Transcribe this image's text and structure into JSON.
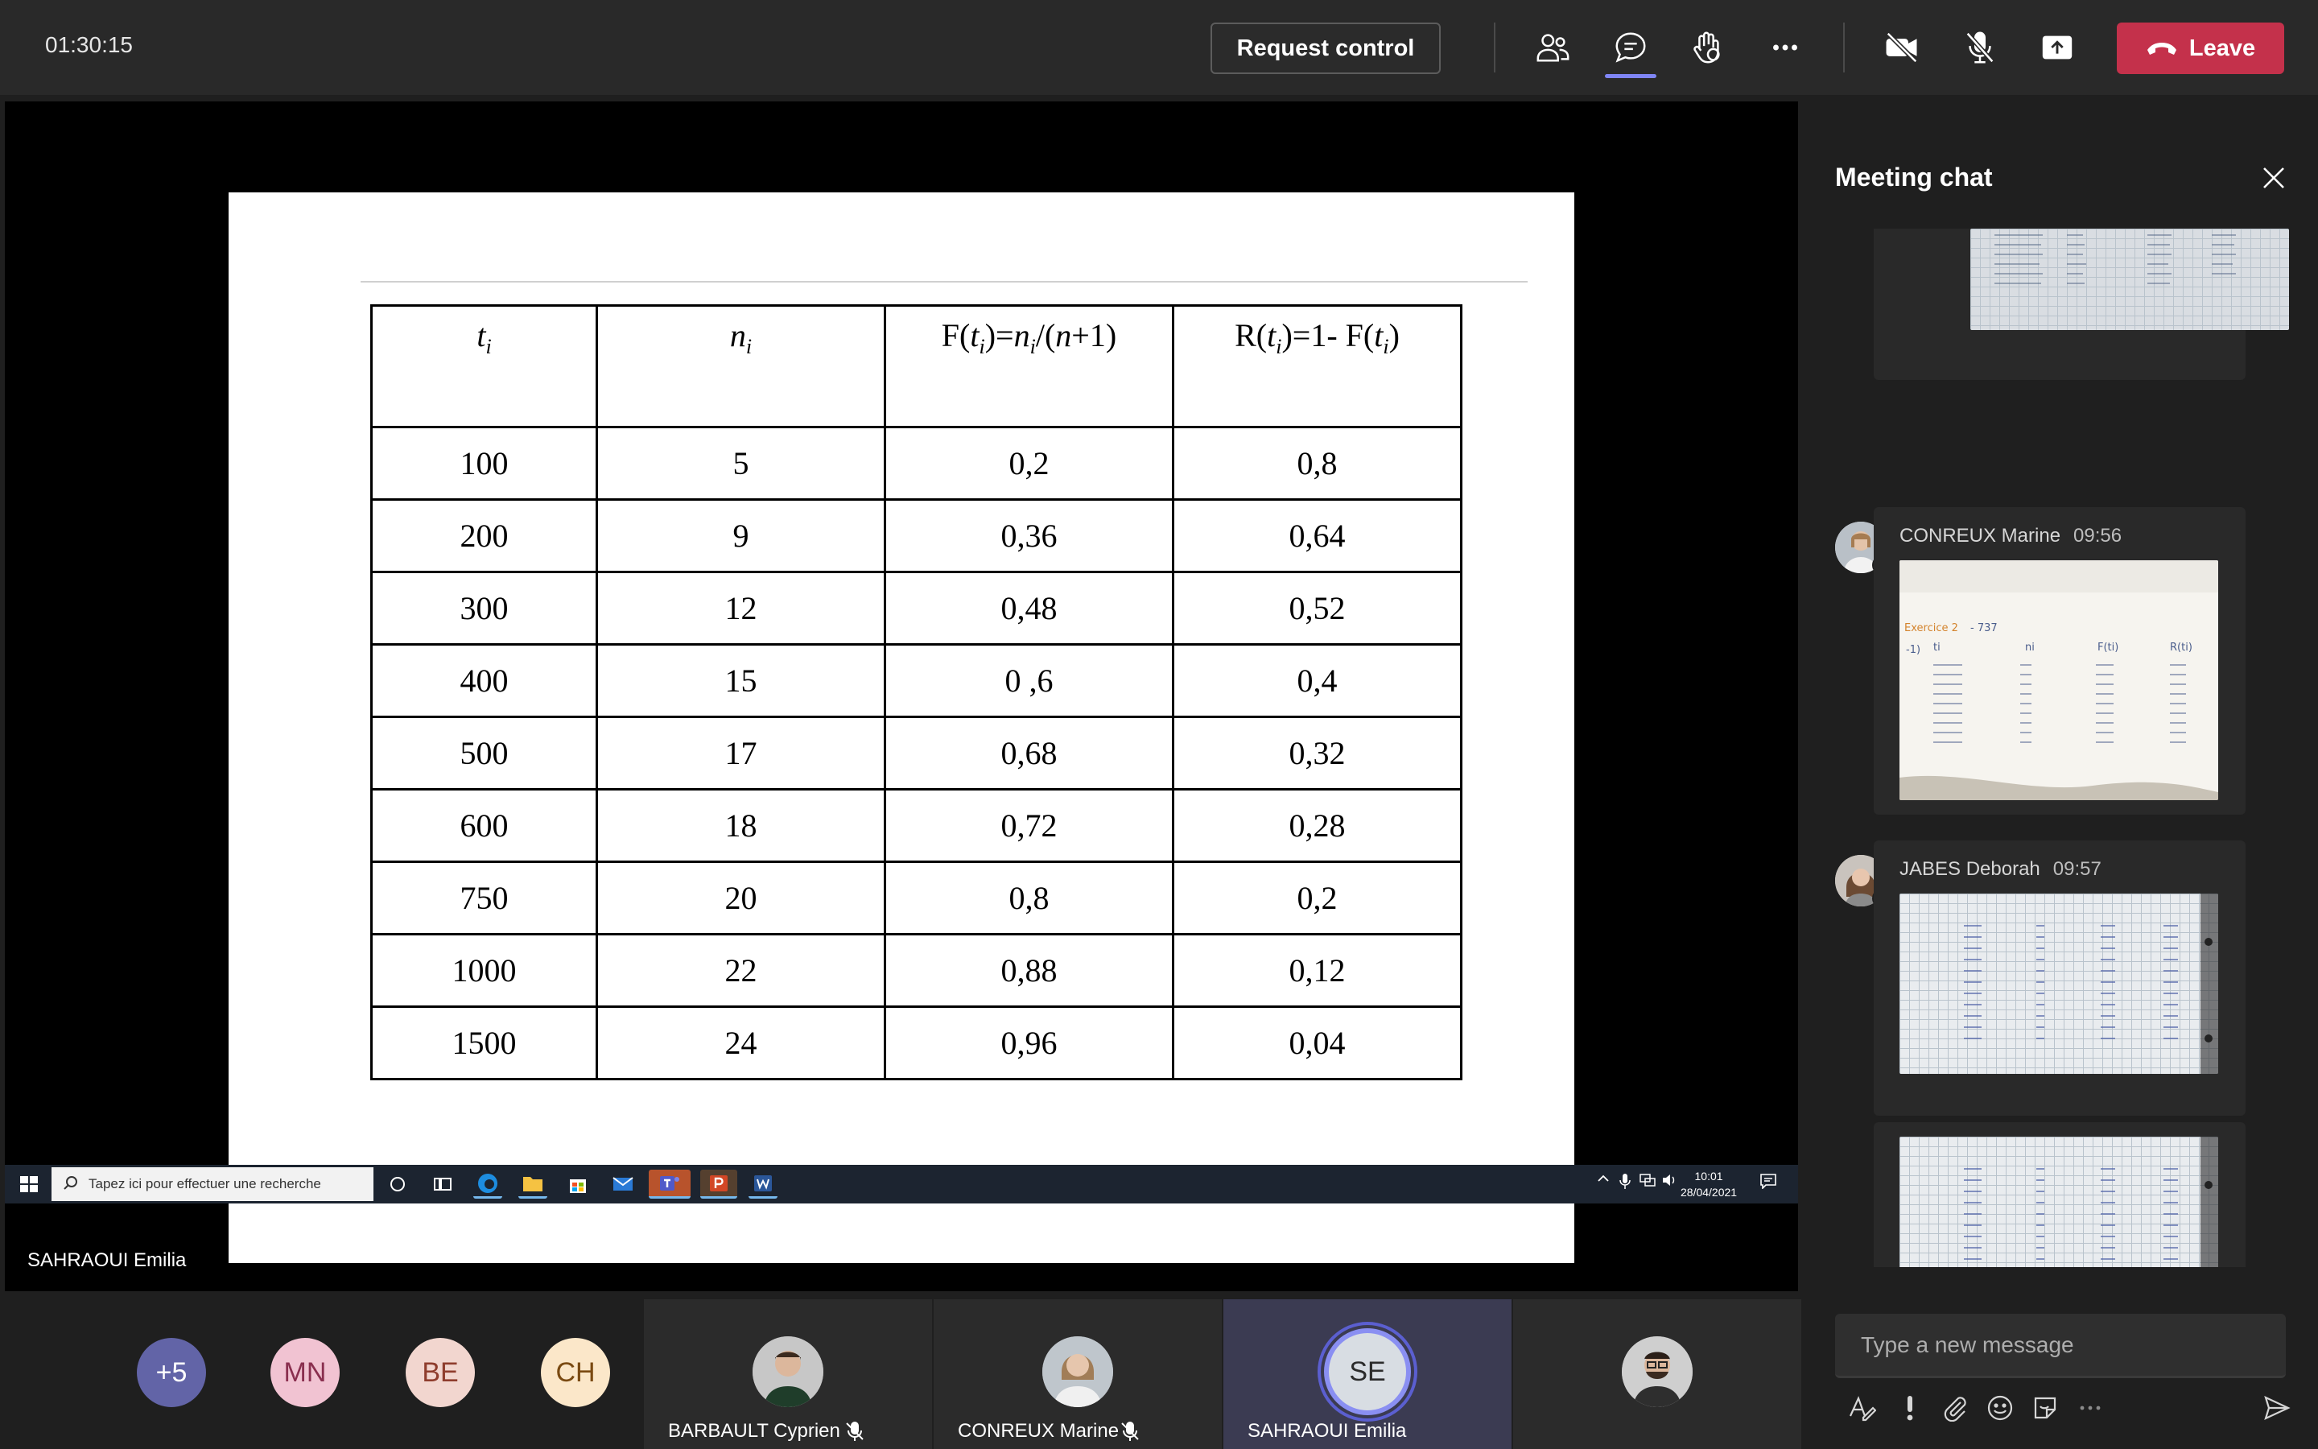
{
  "meeting": {
    "timer": "01:30:15",
    "request_control": "Request control",
    "leave": "Leave"
  },
  "toolbar_icons": [
    "participants-icon",
    "chat-icon",
    "raise-hand-icon",
    "more-options-icon",
    "camera-off-icon",
    "mic-off-icon",
    "share-tray-icon"
  ],
  "slide": {
    "headers": {
      "c1_var": "t",
      "c1_sub": "i",
      "c2_var": "n",
      "c2_sub": "i",
      "c3": "F(t_i)=n_i/(n+1)",
      "c4": "R(t_i)=1- F(t_i)"
    },
    "rows": [
      [
        "100",
        "5",
        "0,2",
        "0,8"
      ],
      [
        "200",
        "9",
        "0,36",
        "0,64"
      ],
      [
        "300",
        "12",
        "0,48",
        "0,52"
      ],
      [
        "400",
        "15",
        "0 ,6",
        "0,4"
      ],
      [
        "500",
        "17",
        "0,68",
        "0,32"
      ],
      [
        "600",
        "18",
        "0,72",
        "0,28"
      ],
      [
        "750",
        "20",
        "0,8",
        "0,2"
      ],
      [
        "1000",
        "22",
        "0,88",
        "0,12"
      ],
      [
        "1500",
        "24",
        "0,96",
        "0,04"
      ]
    ]
  },
  "taskbar": {
    "search_placeholder": "Tapez ici pour effectuer une recherche",
    "time": "10:01",
    "date": "28/04/2021"
  },
  "presenter": "SAHRAOUI Emilia",
  "chat": {
    "title": "Meeting chat",
    "messages": [
      {
        "sender": "CONREUX Marine",
        "time": "09:56"
      },
      {
        "sender": "JABES Deborah",
        "time": "09:57"
      }
    ],
    "composer_placeholder": "Type a new message"
  },
  "participants": {
    "overflow": "+5",
    "initials": [
      "MN",
      "BE",
      "CH"
    ],
    "tiles": [
      {
        "name": "BARBAULT Cyprien"
      },
      {
        "name": "CONREUX Marine"
      },
      {
        "name": "SAHRAOUI Emilia",
        "initials": "SE"
      }
    ]
  },
  "colors": {
    "leave": "#c4314b",
    "accent": "#7f85f5",
    "mn_bg": "#f1c3d2",
    "be_bg": "#f2d6cf",
    "ch_bg": "#fbe7c9",
    "overflow_bg": "#6264a7"
  }
}
